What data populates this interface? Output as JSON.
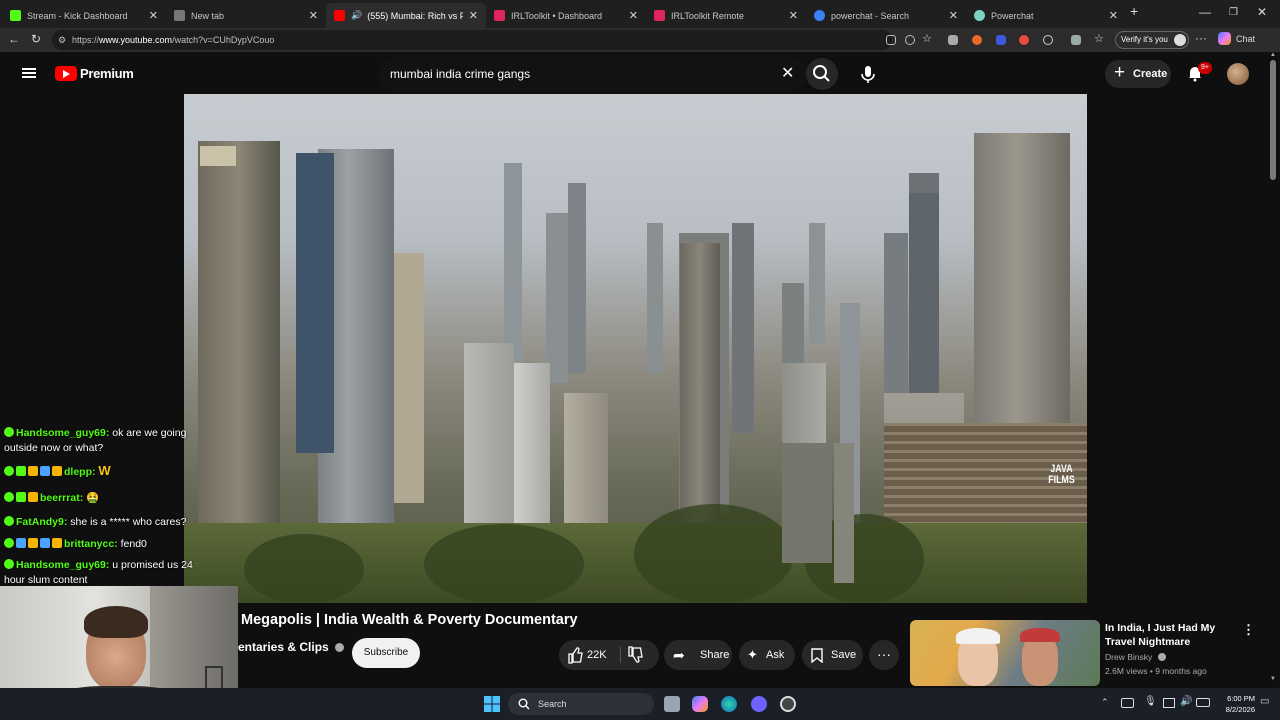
{
  "browser": {
    "tabs": [
      {
        "title": "Stream - Kick Dashboard",
        "favicon_color": "#53fc18",
        "active": false
      },
      {
        "title": "New tab",
        "favicon_color": "#777777",
        "active": false
      },
      {
        "title": "(555) Mumbai: Rich vs Poor in",
        "favicon_color": "#ff0000",
        "active": true
      },
      {
        "title": "IRLToolkit • Dashboard",
        "favicon_color": "#e0245e",
        "active": false
      },
      {
        "title": "IRLToolkit Remote",
        "favicon_color": "#e0245e",
        "active": false
      },
      {
        "title": "powerchat - Search",
        "favicon_color": "#3b82f6",
        "active": false
      },
      {
        "title": "Powerchat",
        "favicon_color": "#7dd3c0",
        "active": false
      }
    ],
    "url_prefix": "https://",
    "url_host": "www.youtube.com",
    "url_path": "/watch?v=CUhDypVCouo",
    "verify_label": "Verify it's you",
    "chat_label": "Chat"
  },
  "youtube": {
    "logo_text": "Premium",
    "search_query": "mumbai india crime gangs",
    "create_label": "Create",
    "notification_count": "9+",
    "video": {
      "watermark_line1": "JAVA",
      "watermark_line2": "FILMS",
      "title": "Megapolis | India Wealth & Poverty Documentary",
      "channel": "entaries & Clips",
      "subscribe_label": "Subscribe",
      "likes": "22K",
      "share_label": "Share",
      "ask_label": "Ask",
      "save_label": "Save"
    },
    "recommended": {
      "title": "In India, I Just Had My Travel Nightmare",
      "channel": "Drew Binsky",
      "meta": "2.6M views • 9 months ago"
    }
  },
  "chat": [
    {
      "user": "Handsome_guy69:",
      "text": "ok are we going outside now or what?",
      "badges": [
        "#53fc18"
      ]
    },
    {
      "user": "dlepp:",
      "text": "W",
      "badges": [
        "#53fc18",
        "#53fc18",
        "#f5b400",
        "#4aa3ff",
        "#f5b400"
      ]
    },
    {
      "user": "beerrrat:",
      "text": "🤮",
      "badges": [
        "#53fc18",
        "#53fc18",
        "#f5b400"
      ]
    },
    {
      "user": "FatAndy9:",
      "text": "she is a ***** who cares?",
      "badges": [
        "#53fc18"
      ]
    },
    {
      "user": "brittanycc:",
      "text": "fend0",
      "badges": [
        "#53fc18",
        "#4aa3ff",
        "#f5b400",
        "#4aa3ff",
        "#f5b400"
      ]
    },
    {
      "user": "Handsome_guy69:",
      "text": "u promised us 24 hour slum content",
      "badges": [
        "#53fc18"
      ]
    }
  ],
  "taskbar": {
    "search_label": "Search",
    "time": "6:00 PM",
    "date": "8/2/2026"
  }
}
